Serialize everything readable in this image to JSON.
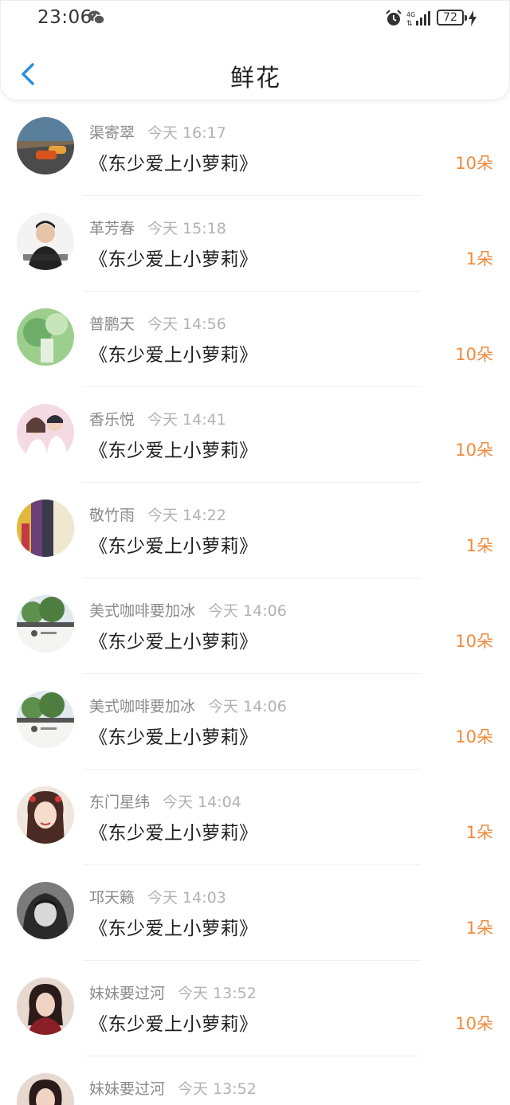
{
  "status_bar": {
    "time": "23:06",
    "network": "4G",
    "battery": "72"
  },
  "header": {
    "title": "鲜花"
  },
  "colors": {
    "accent": "#2c8fe0",
    "count": "#f08a3c"
  },
  "list": {
    "items": [
      {
        "name": "渠寄翠",
        "time": "今天 16:17",
        "book": "《东少爱上小萝莉》",
        "count": "10朵",
        "avatar": "car-avatar"
      },
      {
        "name": "革芳春",
        "time": "今天 15:18",
        "book": "《东少爱上小萝莉》",
        "count": "1朵",
        "avatar": "boy-avatar"
      },
      {
        "name": "普鹏天",
        "time": "今天 14:56",
        "book": "《东少爱上小萝莉》",
        "count": "10朵",
        "avatar": "green-avatar"
      },
      {
        "name": "香乐悦",
        "time": "今天 14:41",
        "book": "《东少爱上小萝莉》",
        "count": "10朵",
        "avatar": "couple-avatar"
      },
      {
        "name": "敬竹雨",
        "time": "今天 14:22",
        "book": "《东少爱上小萝莉》",
        "count": "1朵",
        "avatar": "colorful-avatar"
      },
      {
        "name": "美式咖啡要加冰",
        "time": "今天 14:06",
        "book": "《东少爱上小萝莉》",
        "count": "10朵",
        "avatar": "cafe-avatar"
      },
      {
        "name": "美式咖啡要加冰",
        "time": "今天 14:06",
        "book": "《东少爱上小萝莉》",
        "count": "10朵",
        "avatar": "cafe-avatar"
      },
      {
        "name": "东门星纬",
        "time": "今天 14:04",
        "book": "《东少爱上小萝莉》",
        "count": "1朵",
        "avatar": "girl-avatar"
      },
      {
        "name": "邛天籁",
        "time": "今天 14:03",
        "book": "《东少爱上小萝莉》",
        "count": "1朵",
        "avatar": "hood-avatar"
      },
      {
        "name": "妹妹要过河",
        "time": "今天 13:52",
        "book": "《东少爱上小萝莉》",
        "count": "10朵",
        "avatar": "woman-avatar"
      },
      {
        "name": "妹妹要过河",
        "time": "今天 13:52",
        "book": "",
        "count": "",
        "avatar": "woman-avatar"
      }
    ]
  }
}
